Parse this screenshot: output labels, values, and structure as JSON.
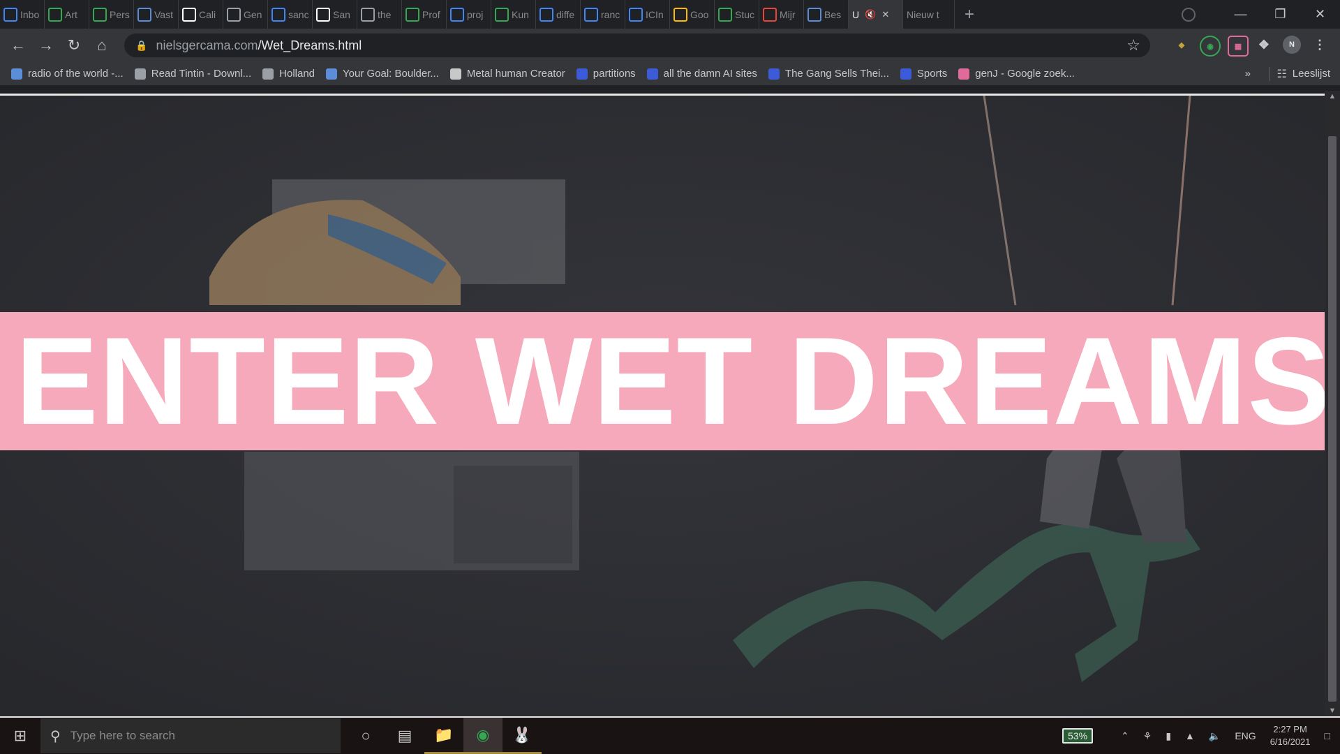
{
  "browser": {
    "tabs": [
      {
        "label": "Inbo",
        "icon": "gmail-icon",
        "color": "#4285f4"
      },
      {
        "label": "Art",
        "icon": "sheets-icon",
        "color": "#34a853"
      },
      {
        "label": "Pers",
        "icon": "sheets-icon",
        "color": "#34a853"
      },
      {
        "label": "Vast",
        "icon": "site-icon",
        "color": "#5b8dd9"
      },
      {
        "label": "Cali",
        "icon": "circle-icon",
        "color": "#ffffff"
      },
      {
        "label": "Gen",
        "icon": "openai-icon",
        "color": "#9aa0a6"
      },
      {
        "label": "sanc",
        "icon": "google-icon",
        "color": "#4285f4"
      },
      {
        "label": "San",
        "icon": "s-icon",
        "color": "#ffffff"
      },
      {
        "label": "the",
        "icon": "openai-icon",
        "color": "#9aa0a6"
      },
      {
        "label": "Prof",
        "icon": "sheets-icon",
        "color": "#34a853"
      },
      {
        "label": "proj",
        "icon": "google-icon",
        "color": "#4285f4"
      },
      {
        "label": "Kun",
        "icon": "sheets-icon",
        "color": "#34a853"
      },
      {
        "label": "diffe",
        "icon": "google-icon",
        "color": "#4285f4"
      },
      {
        "label": "ranc",
        "icon": "google-icon",
        "color": "#4285f4"
      },
      {
        "label": "ICIn",
        "icon": "gmail-icon",
        "color": "#4285f4"
      },
      {
        "label": "Goo",
        "icon": "drive-icon",
        "color": "#fbbc04"
      },
      {
        "label": "Stuc",
        "icon": "sheets-icon",
        "color": "#34a853"
      },
      {
        "label": "Mijr",
        "icon": "music-icon",
        "color": "#e8453c"
      },
      {
        "label": "Bes",
        "icon": "globe-icon",
        "color": "#5b8dd9"
      },
      {
        "label": "U",
        "icon": "",
        "color": "",
        "active": true
      },
      {
        "label": "Nieuw t",
        "icon": "",
        "color": ""
      }
    ],
    "url_host": "nielsgercama.com",
    "url_path": "/Wet_Dreams.html",
    "bookmarks": [
      {
        "label": "radio of the world -...",
        "color": "#5b8dd9"
      },
      {
        "label": "Read Tintin - Downl...",
        "color": "#9aa0a6"
      },
      {
        "label": "Holland",
        "color": "#9aa0a6"
      },
      {
        "label": "Your Goal: Boulder...",
        "color": "#5b8dd9"
      },
      {
        "label": "Metal human Creator",
        "color": "#c8c8c8"
      },
      {
        "label": "partitions",
        "color": "#3b5bd9"
      },
      {
        "label": "all the damn AI sites",
        "color": "#3b5bd9"
      },
      {
        "label": "The Gang Sells Thei...",
        "color": "#3b5bd9"
      },
      {
        "label": "Sports",
        "color": "#3b5bd9"
      },
      {
        "label": "genJ - Google zoek...",
        "color": "#e06b9a"
      }
    ],
    "bookmarks_overflow": "»",
    "reading_list": "Leeslijst",
    "profile_initial": "N"
  },
  "page": {
    "banner_text": "ENTER WET DREAMS",
    "banner_color": "#f5a9bb",
    "background_color": "#2d2e33"
  },
  "taskbar": {
    "search_placeholder": "Type here to search",
    "battery": "53%",
    "lang": "ENG",
    "time": "2:27 PM",
    "date": "6/16/2021"
  }
}
